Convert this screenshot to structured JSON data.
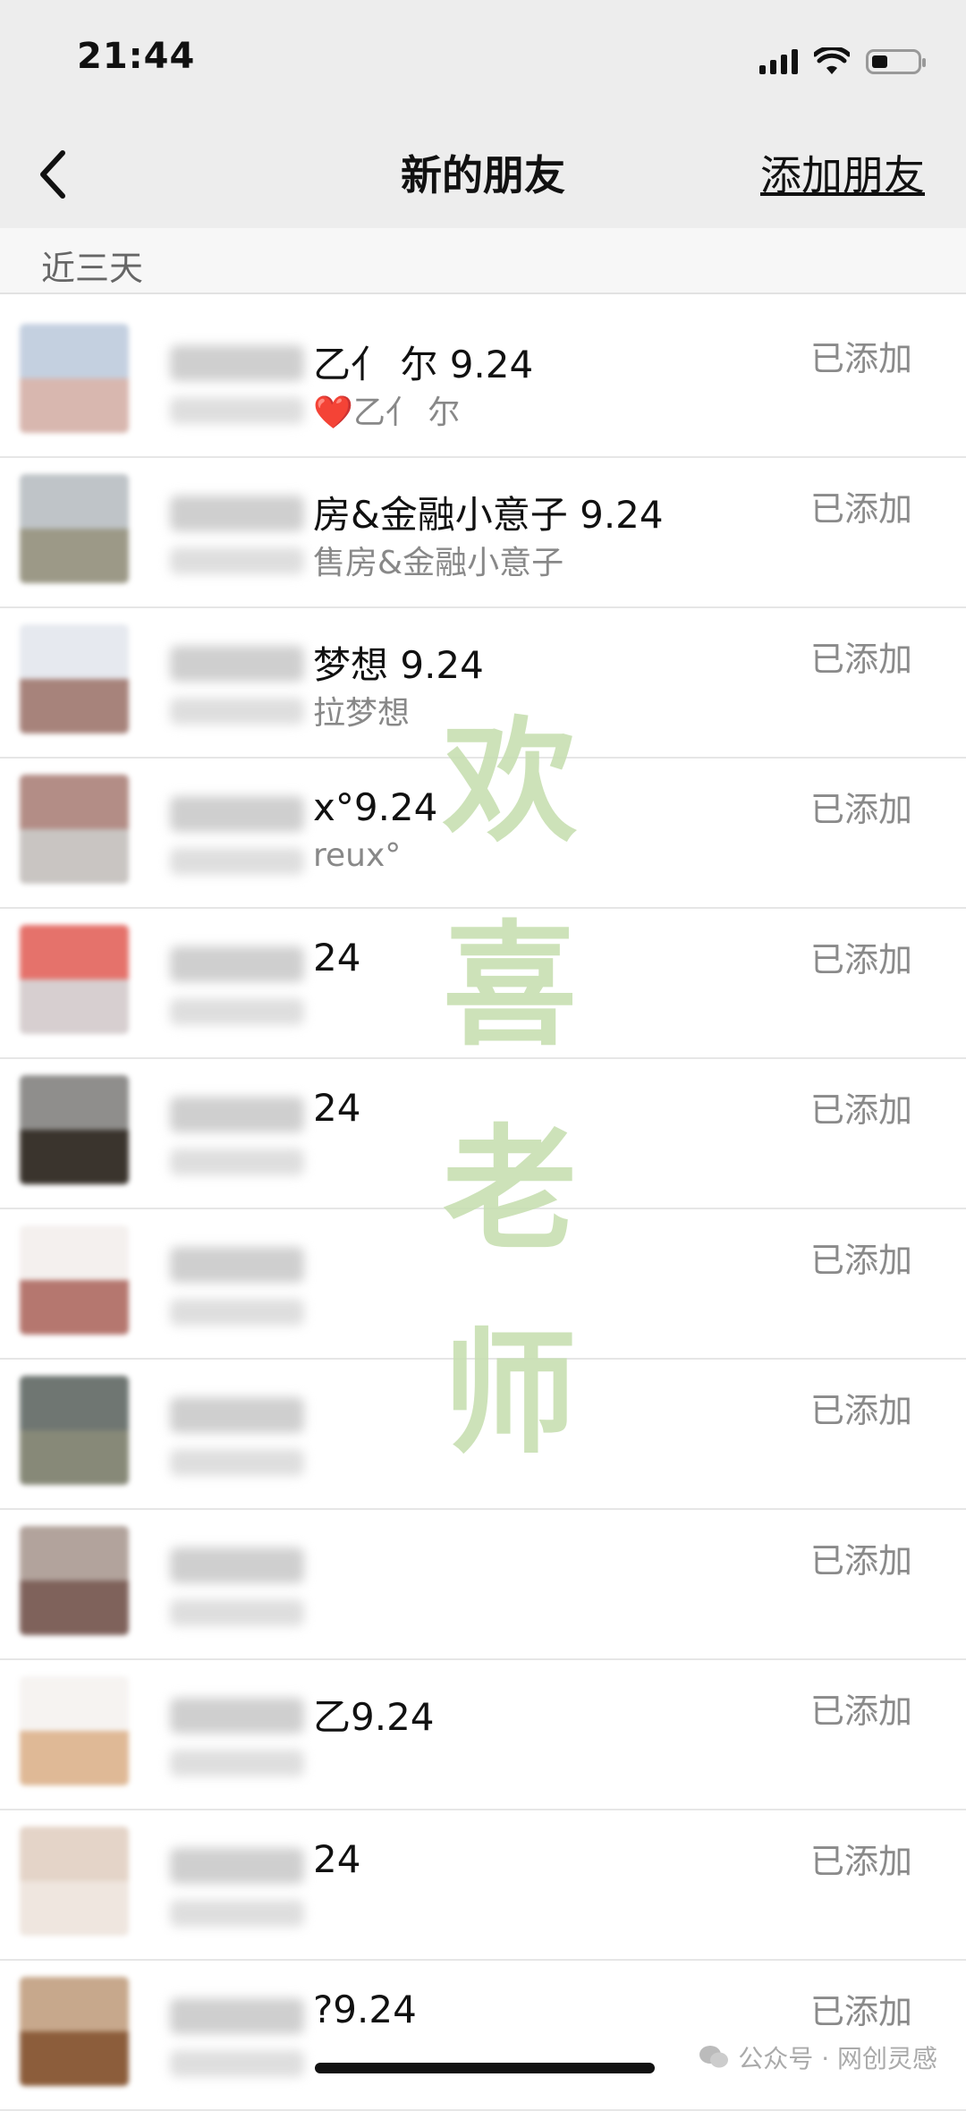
{
  "status_bar": {
    "time": "21:44",
    "battery_level": 0.35
  },
  "nav": {
    "title": "新的朋友",
    "action": "添加朋友",
    "back_icon": "chevron-left-icon"
  },
  "section": {
    "label": "近三天"
  },
  "rows": [
    {
      "name": "乙亻 尔 9.24",
      "sub": "❤️乙亻 尔",
      "status": "已添加",
      "avatar_colors": [
        "#c4d0e0",
        "#d8b7af"
      ]
    },
    {
      "name": "房&金融小意子 9.24",
      "sub": "售房&金融小意子",
      "status": "已添加",
      "avatar_colors": [
        "#bfc4c8",
        "#9c9987"
      ]
    },
    {
      "name": "梦想 9.24",
      "sub": "拉梦想",
      "status": "已添加",
      "avatar_colors": [
        "#e6e9ef",
        "#a7837b"
      ]
    },
    {
      "name": "x°9.24",
      "sub": "reux°",
      "status": "已添加",
      "avatar_colors": [
        "#b38d86",
        "#c9c5c2"
      ]
    },
    {
      "name": "24",
      "sub": "",
      "status": "已添加",
      "avatar_colors": [
        "#e5726b",
        "#d7cfd0"
      ]
    },
    {
      "name": "24",
      "sub": "",
      "status": "已添加",
      "avatar_colors": [
        "#8f8e8c",
        "#3a342d"
      ]
    },
    {
      "name": "",
      "sub": "",
      "status": "已添加",
      "avatar_colors": [
        "#f4f0ee",
        "#b5776f"
      ]
    },
    {
      "name": "",
      "sub": "",
      "status": "已添加",
      "avatar_colors": [
        "#6f7672",
        "#878978"
      ]
    },
    {
      "name": "",
      "sub": "",
      "status": "已添加",
      "avatar_colors": [
        "#b2a39c",
        "#7f625b"
      ]
    },
    {
      "name": "乙9.24",
      "sub": "",
      "status": "已添加",
      "avatar_colors": [
        "#f6f3f1",
        "#dfb996"
      ]
    },
    {
      "name": "24",
      "sub": "",
      "status": "已添加",
      "avatar_colors": [
        "#e4d4c8",
        "#efe6df"
      ]
    },
    {
      "name": "?9.24",
      "sub": "",
      "status": "已添加",
      "avatar_colors": [
        "#c7a88c",
        "#8c5d3b"
      ]
    }
  ],
  "watermark": {
    "line1": "欢",
    "line2": "喜",
    "line3": "老",
    "line4": "师"
  },
  "footer": {
    "text": "公众号 · 网创灵感"
  }
}
